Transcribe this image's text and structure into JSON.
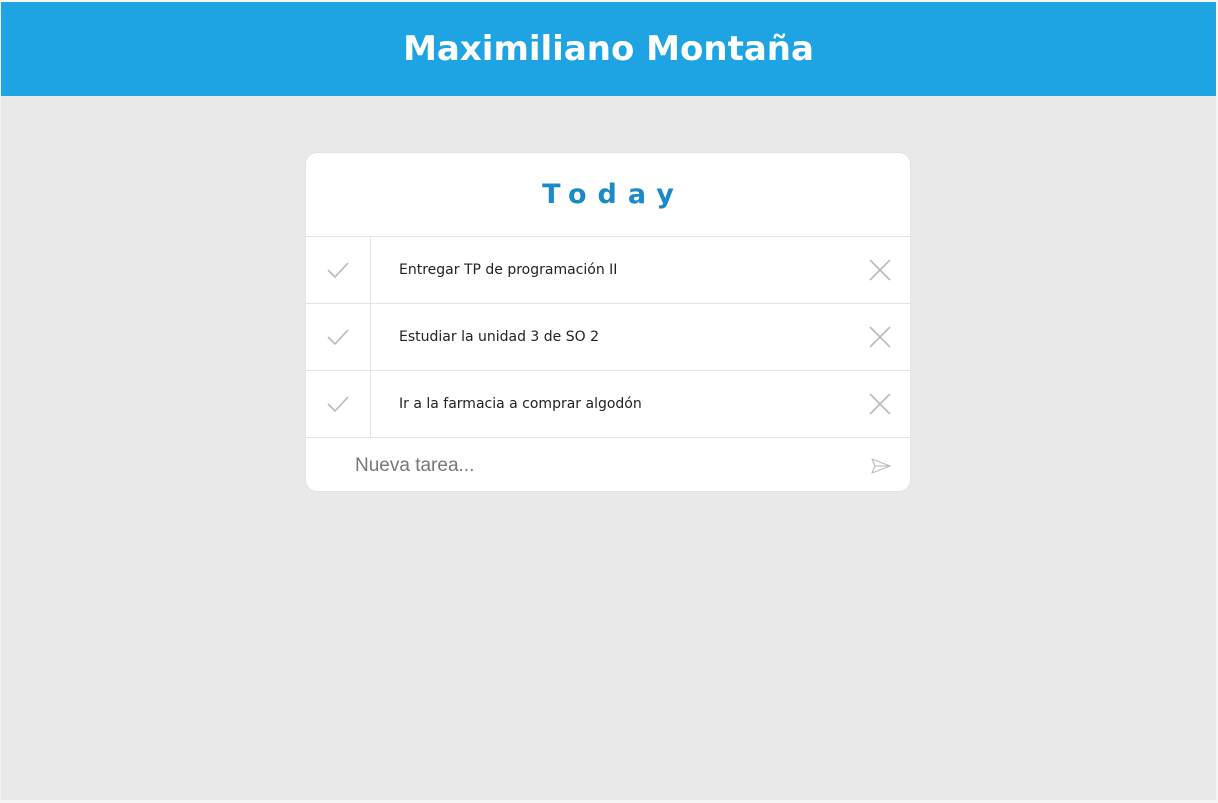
{
  "header": {
    "title": "Maximiliano Montaña"
  },
  "card": {
    "title": "Today",
    "tasks": [
      {
        "label": "Entregar TP de programación II",
        "check_icon": "check-icon",
        "delete_icon": "close-icon"
      },
      {
        "label": "Estudiar la unidad 3 de SO 2",
        "check_icon": "check-icon",
        "delete_icon": "close-icon"
      },
      {
        "label": "Ir a la farmacia a comprar algodón",
        "check_icon": "check-icon",
        "delete_icon": "close-icon"
      }
    ],
    "new_task": {
      "placeholder": "Nueva tarea...",
      "value": "",
      "send_icon": "send-icon"
    }
  },
  "colors": {
    "header_bg": "#1ea4e2",
    "title_accent": "#1a8ac9",
    "page_bg": "#e9e9e9",
    "icon_gray": "#b9b9b9"
  }
}
